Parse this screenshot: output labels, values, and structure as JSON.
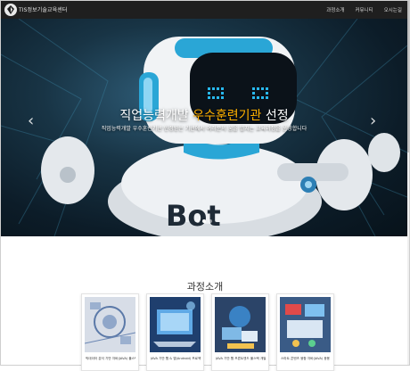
{
  "header": {
    "brand": "TIS정보기술교육센터",
    "nav": [
      "과정소개",
      "커뮤니티",
      "오시는길"
    ]
  },
  "hero": {
    "caption_prefix": "직업능력개발 ",
    "caption_highlight": "우수훈련기관",
    "caption_suffix": " 선정",
    "subcaption": "직업능력개발 우수훈련기관 인정받은 기관에서 여러분의 꿈을 펼치는 교육과정을 운영합니다",
    "robot_text": "Bot",
    "slide_count": 3,
    "active_slide": 1
  },
  "section": {
    "title": "과정소개"
  },
  "courses": [
    {
      "title": "빅데이터 분석 기반 자바(JAVA) 풀스택 개발자 양성과정"
    },
    {
      "title": "JAVA 기반 웹 & 앱(Android) 프로젝트 개발자 양성과정"
    },
    {
      "title": "JAVA 기반 웹 프론트엔드 풀스택 개발자 양성과정"
    },
    {
      "title": "스마트 콘텐츠 융합 자바(JAVA) 응용 SW 개발자 양성과정"
    }
  ],
  "colors": {
    "topbar": "#1f1f1f",
    "accent": "#ffb000",
    "robot_eyes": "#28b8ee"
  }
}
